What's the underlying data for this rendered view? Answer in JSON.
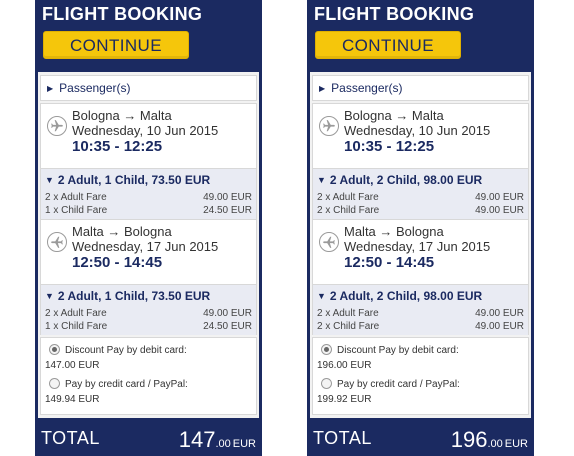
{
  "panels": [
    {
      "header_title": "FLIGHT BOOKING",
      "continue_label": "CONTINUE",
      "passengers_label": "Passenger(s)",
      "flights": [
        {
          "route": "Bologna → Malta",
          "date": "Wednesday, 10 Jun 2015",
          "times": "10:35 - 12:25",
          "summary": "2 Adult, 1 Child, 73.50 EUR",
          "fares": [
            {
              "label": "2 x Adult Fare",
              "amount": "49.00 EUR"
            },
            {
              "label": "1 x Child Fare",
              "amount": "24.50 EUR"
            }
          ]
        },
        {
          "route": "Malta → Bologna",
          "date": "Wednesday, 17 Jun 2015",
          "times": "12:50 - 14:45",
          "summary": "2 Adult, 1 Child, 73.50 EUR",
          "fares": [
            {
              "label": "2 x Adult Fare",
              "amount": "49.00 EUR"
            },
            {
              "label": "1 x Child Fare",
              "amount": "24.50 EUR"
            }
          ]
        }
      ],
      "payment": {
        "debit_label": "Discount Pay by debit card:",
        "debit_amount": "147.00 EUR",
        "credit_label": "Pay by credit card / PayPal:",
        "credit_amount": "149.94 EUR",
        "selected": "debit"
      },
      "total": {
        "label": "TOTAL",
        "integer": "147",
        "decimal": ".00",
        "currency": "EUR"
      }
    },
    {
      "header_title": "FLIGHT BOOKING",
      "continue_label": "CONTINUE",
      "passengers_label": "Passenger(s)",
      "flights": [
        {
          "route": "Bologna → Malta",
          "date": "Wednesday, 10 Jun 2015",
          "times": "10:35 - 12:25",
          "summary": "2 Adult, 2 Child, 98.00 EUR",
          "fares": [
            {
              "label": "2 x Adult Fare",
              "amount": "49.00 EUR"
            },
            {
              "label": "2 x Child Fare",
              "amount": "49.00 EUR"
            }
          ]
        },
        {
          "route": "Malta → Bologna",
          "date": "Wednesday, 17 Jun 2015",
          "times": "12:50 - 14:45",
          "summary": "2 Adult, 2 Child, 98.00 EUR",
          "fares": [
            {
              "label": "2 x Adult Fare",
              "amount": "49.00 EUR"
            },
            {
              "label": "2 x Child Fare",
              "amount": "49.00 EUR"
            }
          ]
        }
      ],
      "payment": {
        "debit_label": "Discount Pay by debit card:",
        "debit_amount": "196.00 EUR",
        "credit_label": "Pay by credit card / PayPal:",
        "credit_amount": "199.92 EUR",
        "selected": "debit"
      },
      "total": {
        "label": "TOTAL",
        "integer": "196",
        "decimal": ".00",
        "currency": "EUR"
      }
    }
  ],
  "icons": {
    "passengers_toggle": "triangle-right-icon",
    "fare_toggle": "triangle-down-icon",
    "flight": "airplane-icon"
  },
  "colors": {
    "brand_navy": "#1b2a61",
    "button_yellow": "#f5c60b",
    "fare_background": "#e9ebf3"
  }
}
